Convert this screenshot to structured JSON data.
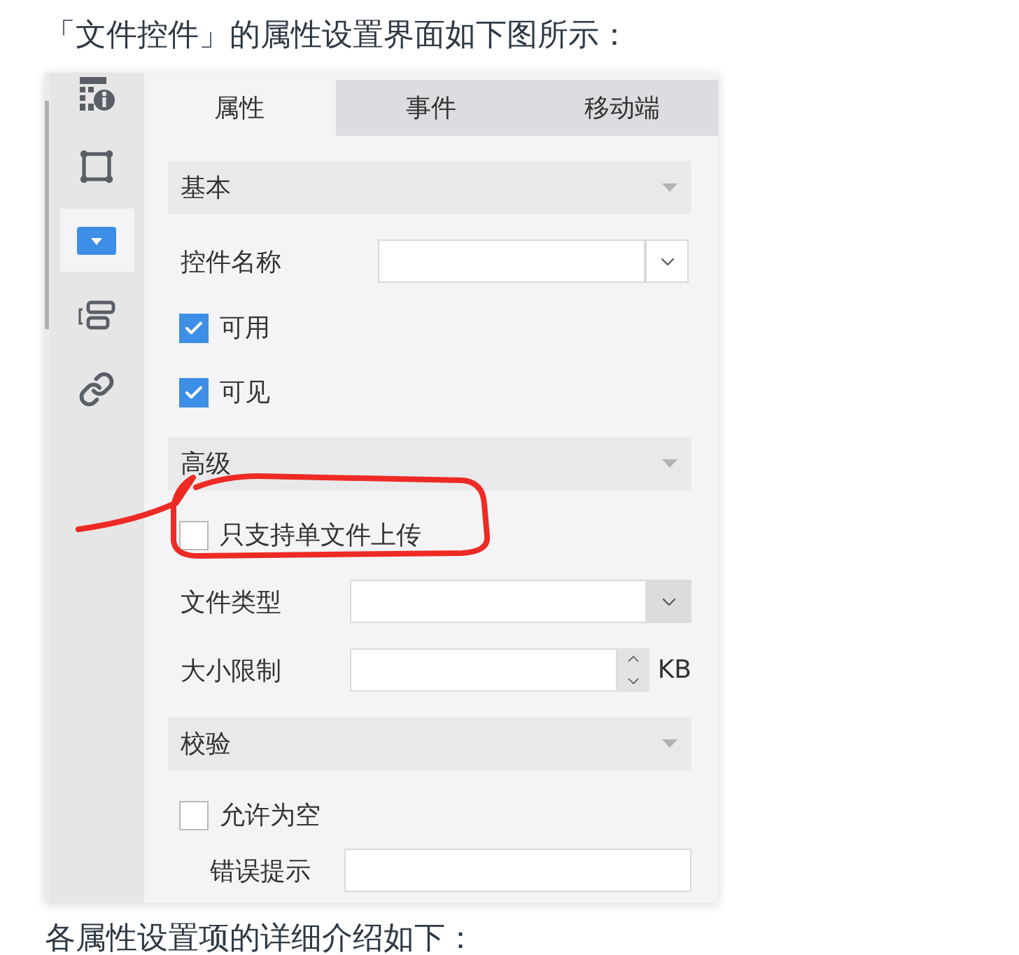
{
  "intro": "「文件控件」的属性设置界面如下图所示：",
  "screenshot": {
    "sidebar": {
      "items": [
        {
          "selected": false
        },
        {
          "selected": false
        },
        {
          "selected": true
        },
        {
          "selected": false
        },
        {
          "selected": false
        }
      ]
    },
    "tabs": [
      {
        "label": "属性",
        "selected": true
      },
      {
        "label": "事件",
        "selected": false
      },
      {
        "label": "移动端",
        "selected": false
      }
    ],
    "sections": [
      {
        "title": "基本",
        "rows": [
          {
            "kind": "combo",
            "label": "控件名称"
          },
          {
            "kind": "checkbox",
            "label": "可用",
            "checked": true
          },
          {
            "kind": "checkbox",
            "label": "可见",
            "checked": true
          }
        ]
      },
      {
        "title": "高级",
        "rows": [
          {
            "kind": "checkbox",
            "label": "只支持单文件上传",
            "checked": false
          },
          {
            "kind": "select",
            "label": "文件类型"
          },
          {
            "kind": "number",
            "label": "大小限制",
            "unit": "KB"
          }
        ]
      },
      {
        "title": "校验",
        "rows": [
          {
            "kind": "checkbox",
            "label": "允许为空",
            "checked": false
          },
          {
            "kind": "text",
            "label": "错误提示"
          }
        ]
      }
    ]
  },
  "outro": "各属性设置项的详细介绍如下："
}
